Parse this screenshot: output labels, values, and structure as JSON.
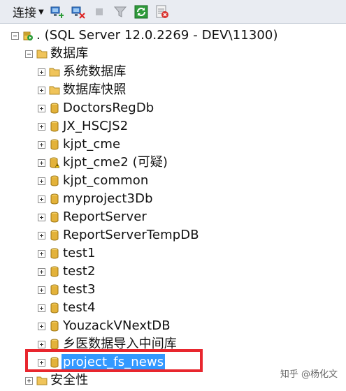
{
  "toolbar": {
    "connect_label": "连接",
    "buttons": [
      {
        "icon": "connect-server-icon"
      },
      {
        "icon": "disconnect-icon"
      },
      {
        "icon": "stop-icon"
      },
      {
        "icon": "filter-icon"
      },
      {
        "icon": "refresh-icon"
      },
      {
        "icon": "activity-monitor-icon"
      }
    ]
  },
  "tree": {
    "server": ". (SQL Server 12.0.2269 - DEV\\11300)",
    "databases_folder": "数据库",
    "system_databases": "系统数据库",
    "db_snapshots": "数据库快照",
    "databases": [
      "DoctorsRegDb",
      "JX_HSCJS2",
      "kjpt_cme",
      "kjpt_cme2 (可疑)",
      "kjpt_common",
      "myproject3Db",
      "ReportServer",
      "ReportServerTempDB",
      "test1",
      "test2",
      "test3",
      "test4",
      "YouzackVNextDB",
      "乡医数据导入中间库",
      "project_fs_news"
    ],
    "selected_database": "project_fs_news",
    "suspect_database": "kjpt_cme2 (可疑)",
    "security_folder": "安全性"
  },
  "watermark": "知乎 @杨化文",
  "colors": {
    "selection": "#3399ff",
    "highlight_box": "#e8262e",
    "folder": "#e8b84a",
    "database": "#d9a320"
  }
}
